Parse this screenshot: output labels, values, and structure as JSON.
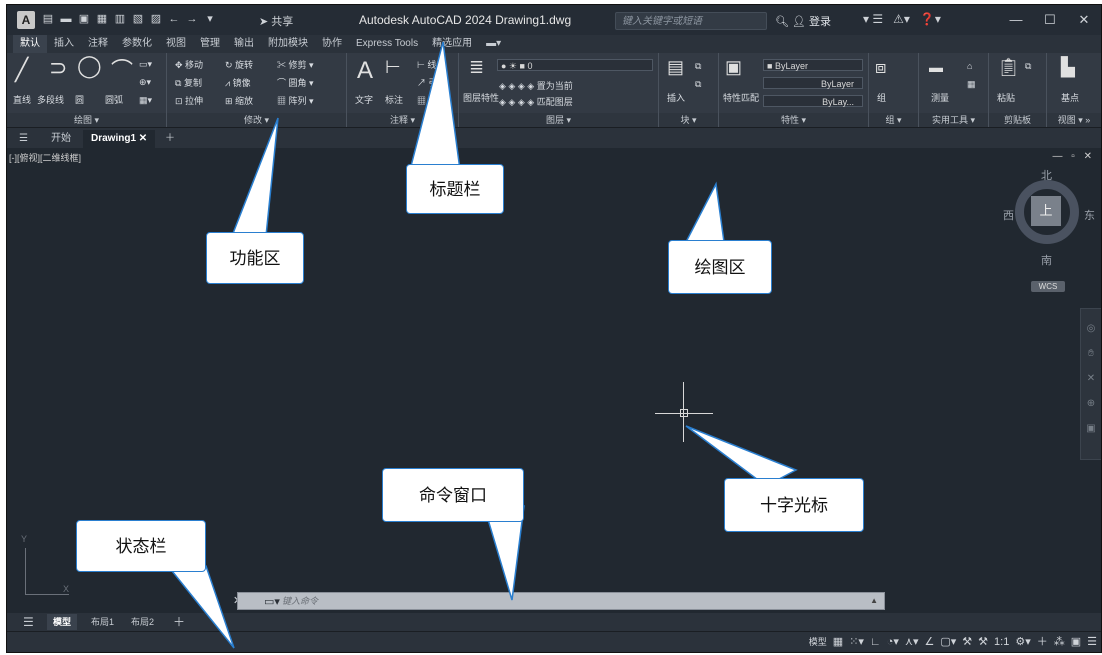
{
  "titlebar": {
    "logo": "A",
    "share": "共享",
    "title": "Autodesk AutoCAD 2024   Drawing1.dwg",
    "search_placeholder": "键入关键字或短语",
    "login": "登录"
  },
  "ribbon_tabs": [
    "默认",
    "插入",
    "注释",
    "参数化",
    "视图",
    "管理",
    "输出",
    "附加模块",
    "协作",
    "Express Tools",
    "精选应用"
  ],
  "panels": {
    "draw": {
      "title": "绘图 ▾",
      "tools": [
        "直线",
        "多段线",
        "圆",
        "圆弧"
      ]
    },
    "modify": {
      "title": "修改 ▾",
      "tools": [
        "移动",
        "旋转",
        "修剪",
        "复制",
        "镜像",
        "圆角",
        "拉伸",
        "缩放",
        "阵列"
      ]
    },
    "annotation": {
      "title": "注释 ▾",
      "tools": [
        "文字",
        "标注",
        "线性",
        "引线",
        "表格"
      ]
    },
    "layers": {
      "title": "图层 ▾",
      "tools": [
        "图层特性",
        "置为当前",
        "匹配图层"
      ],
      "layer_value": "0"
    },
    "block": {
      "title": "块 ▾",
      "tools": [
        "插入"
      ]
    },
    "properties": {
      "title": "特性 ▾",
      "tools": [
        "特性匹配"
      ],
      "values": [
        "ByLayer",
        "ByLayer",
        "ByLay..."
      ]
    },
    "groups": {
      "title": "组 ▾",
      "tools": [
        "组"
      ]
    },
    "utilities": {
      "title": "实用工具 ▾",
      "tools": [
        "测量"
      ]
    },
    "clipboard": {
      "title": "剪贴板",
      "tools": [
        "粘贴"
      ]
    },
    "view": {
      "title": "视图 ▾ »",
      "tools": [
        "基点"
      ]
    }
  },
  "doc_tabs": {
    "start": "开始",
    "drawing": "Drawing1"
  },
  "canvas": {
    "view_label": "[-][俯视][二维线框]",
    "viewcube": {
      "top": "上",
      "north": "北",
      "south": "南",
      "east": "东",
      "west": "西",
      "wcs": "WCS"
    },
    "ucs_x": "X",
    "ucs_y": "Y"
  },
  "command": {
    "placeholder": "键入命令"
  },
  "layout_tabs": [
    "模型",
    "布局1",
    "布局2"
  ],
  "status": {
    "model": "模型",
    "scale": "1:1"
  },
  "callouts": {
    "titlebar": "标题栏",
    "ribbon": "功能区",
    "drawing_area": "绘图区",
    "command_window": "命令窗口",
    "crosshair": "十字光标",
    "statusbar": "状态栏"
  }
}
